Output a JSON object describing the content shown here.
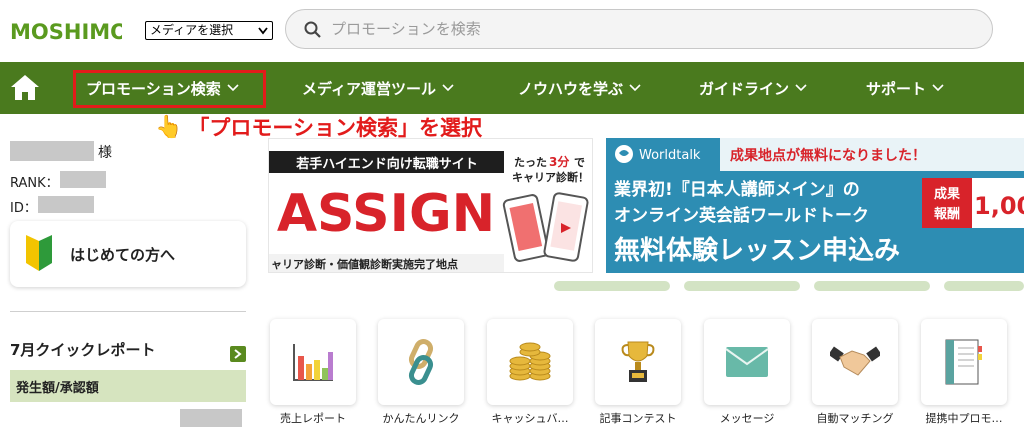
{
  "header": {
    "logo_text": "MOSHIMO",
    "media_select": "メディアを選択",
    "search_placeholder": "プロモーションを検索"
  },
  "nav": {
    "items": [
      {
        "label": "プロモーション検索"
      },
      {
        "label": "メディア運営ツール"
      },
      {
        "label": "ノウハウを学ぶ"
      },
      {
        "label": "ガイドライン"
      },
      {
        "label": "サポート"
      }
    ]
  },
  "annotation": "「プロモーション検索」を選択",
  "sidebar": {
    "user_suffix": "様",
    "rank_label": "RANK：",
    "id_label": "ID：",
    "beginner_label": "はじめての方へ",
    "report_title": "7月クイックレポート",
    "report_header": "発生額/承認額"
  },
  "banners": {
    "assign": {
      "tagline": "若手ハイエンド向け転職サイト",
      "title": "ASSIGN",
      "side_text_1": "たった",
      "side_text_2": "3分",
      "side_text_3": "で",
      "side_text_4": "キャリア診断！",
      "bottom": "ャリア診断・価値観診断実施完了地点"
    },
    "world": {
      "brand": "Worldtalk",
      "headline": "成果地点が無料になりました！",
      "line1": "業界初!『日本人講師メイン』の",
      "line2": "オンライン英会話ワールドトーク",
      "line3": "無料体験レッスン申込み",
      "badge_1": "成果",
      "badge_2": "報酬",
      "badge_amount": "1,00"
    }
  },
  "tiles": [
    {
      "label": "売上レポート",
      "icon": "bar-chart-icon"
    },
    {
      "label": "かんたんリンク",
      "icon": "chain-link-icon"
    },
    {
      "label": "キャッシュバ…",
      "icon": "coin-stack-icon"
    },
    {
      "label": "記事コンテスト",
      "icon": "trophy-icon"
    },
    {
      "label": "メッセージ",
      "icon": "envelope-icon"
    },
    {
      "label": "自動マッチング",
      "icon": "handshake-icon"
    },
    {
      "label": "提携中プロモ…",
      "icon": "document-icon"
    }
  ],
  "colors": {
    "nav_green": "#4a7a1e",
    "highlight_red": "#e21b1b",
    "report_header_bg": "#d6e4bf"
  }
}
